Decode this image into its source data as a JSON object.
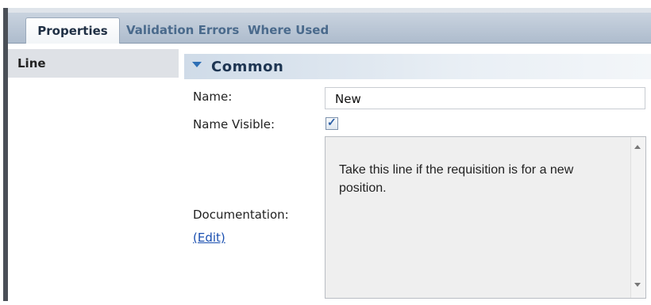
{
  "tabs": [
    {
      "label": "Properties",
      "active": true
    },
    {
      "label": "Validation Errors",
      "active": false
    },
    {
      "label": "Where Used",
      "active": false
    }
  ],
  "nav": {
    "selected": "Line"
  },
  "section": {
    "title": "Common",
    "expanded": true
  },
  "fields": {
    "name_label": "Name:",
    "name_value": "New",
    "name_visible_label": "Name Visible:",
    "name_visible_checked": true,
    "documentation_label": "Documentation:",
    "edit_link": "(Edit)",
    "documentation_text": "Take this line if the requisition is for a new position."
  },
  "icons": {
    "section_toggle": "chevron-down-icon",
    "checkbox_mark": "check-icon",
    "scroll_up": "scroll-up-icon",
    "scroll_down": "scroll-down-icon"
  },
  "colors": {
    "tab_active_text": "#1f2f44",
    "tab_inactive_text": "#4a6a8c",
    "link": "#1a4fb0",
    "section_title": "#1e3552"
  }
}
